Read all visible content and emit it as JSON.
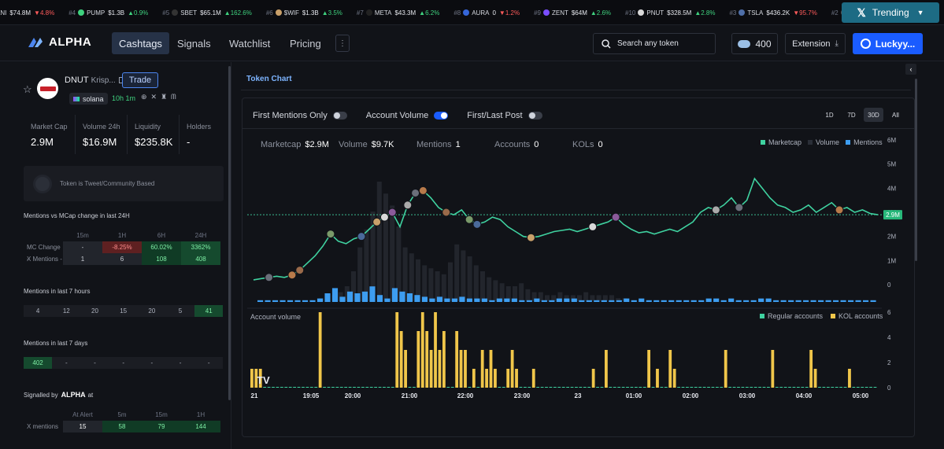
{
  "ticker": [
    {
      "rank": "",
      "sym": "ANI",
      "price": "$74.8M",
      "chg": "4.8%",
      "dir": "down",
      "color": "#444"
    },
    {
      "rank": "#4",
      "sym": "PUMP",
      "price": "$1.3B",
      "chg": "0.9%",
      "dir": "up",
      "color": "#3fd27f"
    },
    {
      "rank": "#5",
      "sym": "SBET",
      "price": "$65.1M",
      "chg": "162.6%",
      "dir": "up",
      "color": "#333"
    },
    {
      "rank": "#6",
      "sym": "$WIF",
      "price": "$1.3B",
      "chg": "3.5%",
      "dir": "up",
      "color": "#c9a06a"
    },
    {
      "rank": "#7",
      "sym": "META",
      "price": "$43.3M",
      "chg": "6.2%",
      "dir": "up",
      "color": "#222"
    },
    {
      "rank": "#8",
      "sym": "AURA",
      "price": "0",
      "chg": "1.2%",
      "dir": "down",
      "color": "#3566d9"
    },
    {
      "rank": "#9",
      "sym": "ZENT",
      "price": "$64M",
      "chg": "2.6%",
      "dir": "up",
      "color": "#7a4dff"
    },
    {
      "rank": "#10",
      "sym": "PNUT",
      "price": "$328.5M",
      "chg": "2.8%",
      "dir": "up",
      "color": "#d9d9d9"
    },
    {
      "rank": "#3",
      "sym": "TSLA",
      "price": "$436.2K",
      "chg": "95.7%",
      "dir": "down",
      "color": "#4f6fa8"
    },
    {
      "rank": "#2",
      "sym": "",
      "price": "",
      "chg": "",
      "dir": "",
      "color": "#555"
    }
  ],
  "trending": {
    "label": "Trending"
  },
  "nav": {
    "logo": "ALPHA",
    "tabs": [
      "Cashtags",
      "Signals",
      "Watchlist",
      "Pricing"
    ],
    "more": "⋮",
    "search_placeholder": "Search any token",
    "credits": "400",
    "extension": "Extension",
    "user": "Luckyy..."
  },
  "token": {
    "symbol": "DNUT",
    "full_name": "Krisp...",
    "trade_label": "Trade",
    "chain": "solana",
    "age": "10h 1m",
    "stats": [
      {
        "label": "Market Cap",
        "value": "2.9M"
      },
      {
        "label": "Volume 24h",
        "value": "$16.9M"
      },
      {
        "label": "Liquidity",
        "value": "$235.8K"
      },
      {
        "label": "Holders",
        "value": "-"
      }
    ],
    "based_text": "Token is Tweet/Community Based"
  },
  "mentions_mcap": {
    "title": "Mentions vs MCap change in last 24H",
    "headers": [
      "",
      "15m",
      "1H",
      "6H",
      "24H"
    ],
    "rows": [
      {
        "label": "MC Change -",
        "cells": [
          "-",
          "-8.25%",
          "60.02%",
          "3362%"
        ]
      },
      {
        "label": "X Mentions -",
        "cells": [
          "1",
          "6",
          "108",
          "408"
        ]
      }
    ]
  },
  "mentions_7h": {
    "title": "Mentions in last 7 hours",
    "values": [
      "4",
      "12",
      "20",
      "15",
      "20",
      "5",
      "41"
    ]
  },
  "mentions_7d": {
    "title": "Mentions in last 7 days",
    "values": [
      "402",
      "-",
      "-",
      "-",
      "-",
      "-",
      "-"
    ]
  },
  "signalled": {
    "prefix": "Signalled by",
    "brand": "ALPHA",
    "suffix": "at",
    "headers": [
      "",
      "At Alert",
      "5m",
      "15m",
      "1H"
    ],
    "rows": [
      {
        "label": "X mentions",
        "cells": [
          "15",
          "58",
          "79",
          "144"
        ]
      }
    ]
  },
  "chart": {
    "title": "Token Chart",
    "toggles": [
      {
        "label": "First Mentions Only",
        "on": false
      },
      {
        "label": "Account Volume",
        "on": true
      },
      {
        "label": "First/Last Post",
        "on": false
      }
    ],
    "ranges": [
      "1D",
      "7D",
      "30D",
      "All"
    ],
    "active_range": "30D",
    "metrics": [
      {
        "label": "Marketcap",
        "value": "$2.9M"
      },
      {
        "label": "Volume",
        "value": "$9.7K"
      },
      {
        "label": "Mentions",
        "value": "1"
      },
      {
        "label": "Accounts",
        "value": "0"
      },
      {
        "label": "KOLs",
        "value": "0"
      }
    ],
    "legend_top": [
      {
        "label": "Marketcap",
        "color": "#3fd2a0"
      },
      {
        "label": "Volume",
        "color": "#2a2e37"
      },
      {
        "label": "Mentions",
        "color": "#3d9df0"
      }
    ],
    "legend_bottom": [
      {
        "label": "Regular accounts",
        "color": "#3fd2a0"
      },
      {
        "label": "KOL accounts",
        "color": "#f0c64a"
      }
    ],
    "account_volume_label": "Account volume",
    "current_value_label": "2.9M"
  },
  "chart_data": {
    "type": "line",
    "title": "Token Chart",
    "xlabel": "",
    "ylabel": "",
    "x_ticks": [
      "21",
      "19:05",
      "20:00",
      "21:00",
      "22:00",
      "23:00",
      "23",
      "01:00",
      "02:00",
      "03:00",
      "04:00",
      "05:00"
    ],
    "y_ticks": [
      "6M",
      "5M",
      "4M",
      "3M",
      "2M",
      "1M",
      "0"
    ],
    "ylim": [
      0,
      6
    ],
    "marketcap_m": [
      0.2,
      0.25,
      0.3,
      0.35,
      0.3,
      0.4,
      0.6,
      0.9,
      1.2,
      1.6,
      2.1,
      1.8,
      1.7,
      1.9,
      2.0,
      2.3,
      2.6,
      2.8,
      3.0,
      2.4,
      3.3,
      3.8,
      3.9,
      3.6,
      3.2,
      3.0,
      2.9,
      3.1,
      2.7,
      2.5,
      2.6,
      2.8,
      2.7,
      2.4,
      2.2,
      2.0,
      1.95,
      2.0,
      2.1,
      2.2,
      2.25,
      2.3,
      2.2,
      2.3,
      2.4,
      2.5,
      2.6,
      2.8,
      2.5,
      2.3,
      2.15,
      2.2,
      2.1,
      2.2,
      2.3,
      2.2,
      2.4,
      2.6,
      3.0,
      3.2,
      3.1,
      3.3,
      3.6,
      3.2,
      3.5,
      4.4,
      4.0,
      3.6,
      3.3,
      3.2,
      3.0,
      3.1,
      3.3,
      3.0,
      3.2,
      3.4,
      3.1,
      3.2,
      3.0,
      3.1,
      2.95,
      2.9
    ],
    "mentions_axis_ticks": [
      "6",
      "4",
      "2",
      "0"
    ],
    "mentions": [
      1,
      1,
      1,
      1,
      1,
      1,
      1,
      1,
      2,
      5,
      8,
      3,
      6,
      5,
      6,
      9,
      4,
      2,
      8,
      6,
      5,
      4,
      3,
      2,
      3,
      2,
      2,
      3,
      2,
      2,
      2,
      1,
      2,
      2,
      2,
      1,
      1,
      2,
      1,
      1,
      2,
      2,
      2,
      1,
      1,
      1,
      1,
      1,
      1,
      2,
      1,
      2,
      1,
      1,
      1,
      1,
      1,
      1,
      1,
      1,
      2,
      2,
      1,
      2,
      1,
      1,
      1,
      2,
      2,
      1,
      1,
      1,
      1,
      1,
      1,
      1,
      1,
      1,
      1,
      1,
      1,
      1,
      1
    ],
    "kol_accounts": [
      1,
      1,
      1,
      0,
      0,
      0,
      0,
      0,
      0,
      0,
      0,
      0,
      0,
      0,
      0,
      0,
      4,
      0,
      0,
      0,
      0,
      0,
      0,
      0,
      0,
      0,
      0,
      0,
      0,
      0,
      0,
      0,
      0,
      0,
      4,
      3,
      2,
      0,
      0,
      3,
      4,
      3,
      2,
      4,
      2,
      3,
      0,
      0,
      3,
      2,
      2,
      0,
      1,
      0,
      2,
      1,
      2,
      1,
      0,
      0,
      1,
      2,
      1,
      0,
      0,
      0,
      1,
      0,
      0,
      0,
      0,
      0,
      0,
      0,
      0,
      0,
      0,
      0,
      0,
      0,
      1,
      0,
      0,
      2,
      0,
      0,
      0,
      0,
      0,
      0,
      0,
      0,
      0,
      2,
      0,
      1,
      0,
      0,
      2,
      1,
      0,
      0,
      0,
      0,
      0,
      0,
      0,
      0,
      0,
      0,
      0,
      2,
      0,
      0,
      0,
      0,
      0,
      0,
      0,
      0,
      0,
      0,
      2,
      0,
      0,
      0,
      0,
      0,
      0,
      0,
      0,
      2,
      1,
      0,
      0,
      0,
      0,
      0,
      0,
      0,
      1,
      0,
      0,
      0,
      0,
      0,
      0
    ]
  }
}
